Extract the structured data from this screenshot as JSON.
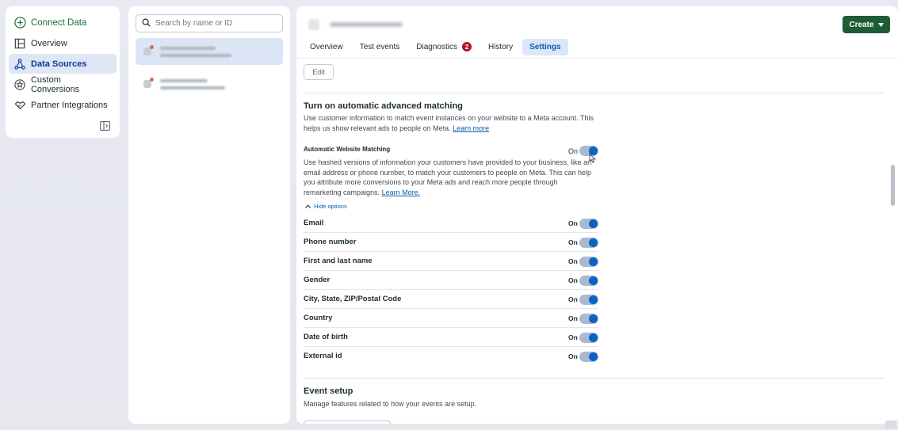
{
  "nav": {
    "connect": "Connect Data",
    "items": [
      {
        "label": "Overview",
        "icon": "layout-icon"
      },
      {
        "label": "Data Sources",
        "icon": "data-sources-icon",
        "active": true
      },
      {
        "label": "Custom Conversions",
        "icon": "star-icon"
      },
      {
        "label": "Partner Integrations",
        "icon": "handshake-icon"
      }
    ]
  },
  "list": {
    "search_placeholder": "Search by name or ID"
  },
  "header": {
    "create_label": "Create",
    "tabs": [
      {
        "label": "Overview"
      },
      {
        "label": "Test events"
      },
      {
        "label": "Diagnostics",
        "badge": "2"
      },
      {
        "label": "History"
      },
      {
        "label": "Settings",
        "active": true
      }
    ]
  },
  "settings": {
    "edit_label": "Edit",
    "aam_title": "Turn on automatic advanced matching",
    "aam_desc_1": "Use customer information to match event instances on your website to a Meta account. This",
    "aam_desc_2": "helps us show relevant ads to people on Meta.",
    "aam_learn": "Learn more",
    "awm_label": "Automatic Website Matching",
    "awm_state": "On",
    "awm_desc_1": "Use hashed versions of information your customers have provided to your business, like an",
    "awm_desc_2": "email address or phone number, to match your customers to people on Meta. This can help",
    "awm_desc_3": "you attribute more conversions to your Meta ads and reach more people through",
    "awm_desc_4": "remarketing campaigns.",
    "awm_learn": "Learn More.",
    "hide_options": "Hide options",
    "options": [
      {
        "label": "Email",
        "state": "On"
      },
      {
        "label": "Phone number",
        "state": "On"
      },
      {
        "label": "First and last name",
        "state": "On"
      },
      {
        "label": "Gender",
        "state": "On"
      },
      {
        "label": "City, State, ZIP/Postal Code",
        "state": "On"
      },
      {
        "label": "Country",
        "state": "On"
      },
      {
        "label": "Date of birth",
        "state": "On"
      },
      {
        "label": "External id",
        "state": "On"
      }
    ],
    "event_title": "Event setup",
    "event_desc": "Manage features related to how your events are setup."
  },
  "colors": {
    "accent": "#0a63c2",
    "create_button": "#1e5c34",
    "badge": "#b5122b"
  }
}
